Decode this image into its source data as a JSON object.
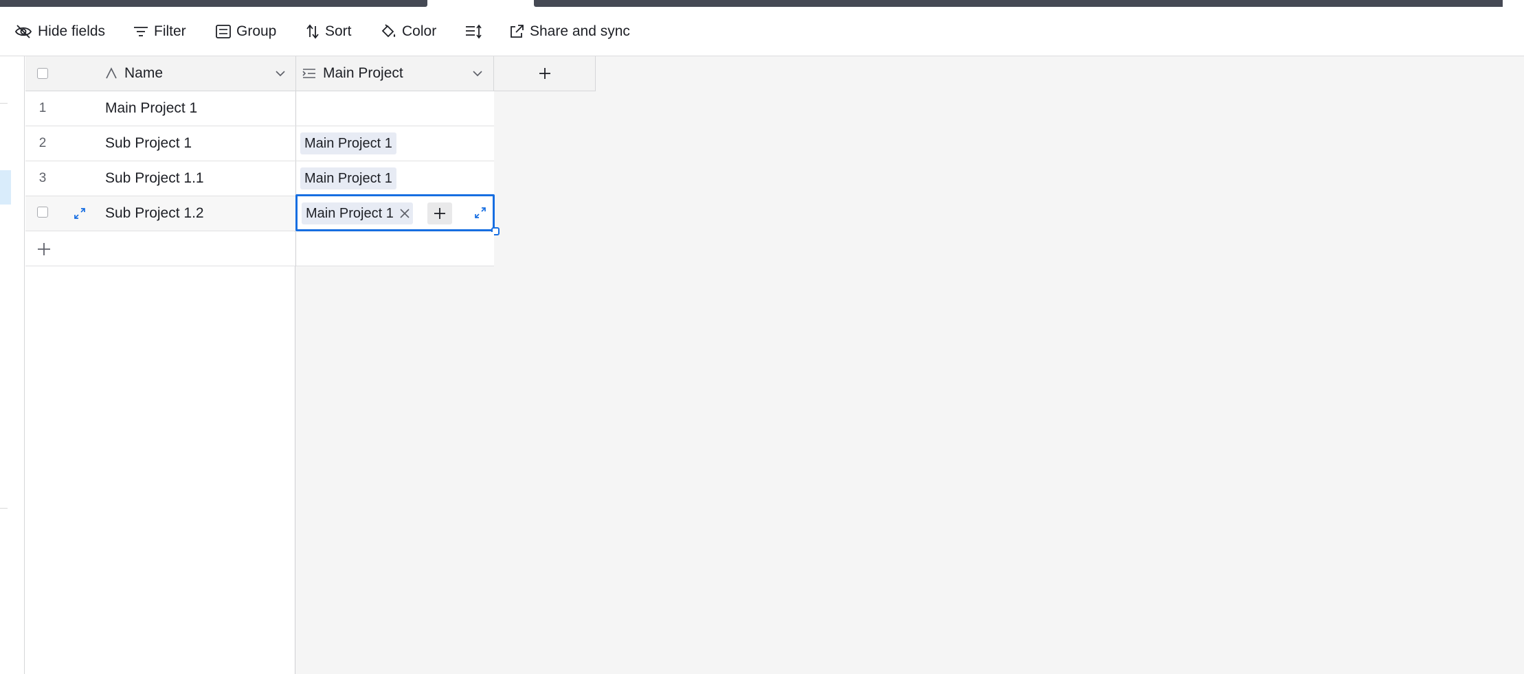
{
  "toolbar": {
    "hide_fields": "Hide fields",
    "filter": "Filter",
    "group": "Group",
    "sort": "Sort",
    "color": "Color",
    "share_sync": "Share and sync"
  },
  "grid": {
    "columns": [
      {
        "label": "Name",
        "icon": "text-field-icon"
      },
      {
        "label": "Main Project",
        "icon": "linked-record-icon"
      }
    ],
    "rows": [
      {
        "num": "1",
        "name": "Main Project 1",
        "link": ""
      },
      {
        "num": "2",
        "name": "Sub Project 1",
        "link": "Main Project 1"
      },
      {
        "num": "3",
        "name": "Sub Project 1.1",
        "link": "Main Project 1"
      },
      {
        "num": "",
        "name": "Sub Project 1.2",
        "link": "Main Project 1",
        "selected": true
      }
    ]
  },
  "colors": {
    "accent": "#176ee1",
    "chip_bg": "#e7ebf4",
    "tab_dark": "#454954",
    "grid_bg": "#f5f5f5"
  }
}
